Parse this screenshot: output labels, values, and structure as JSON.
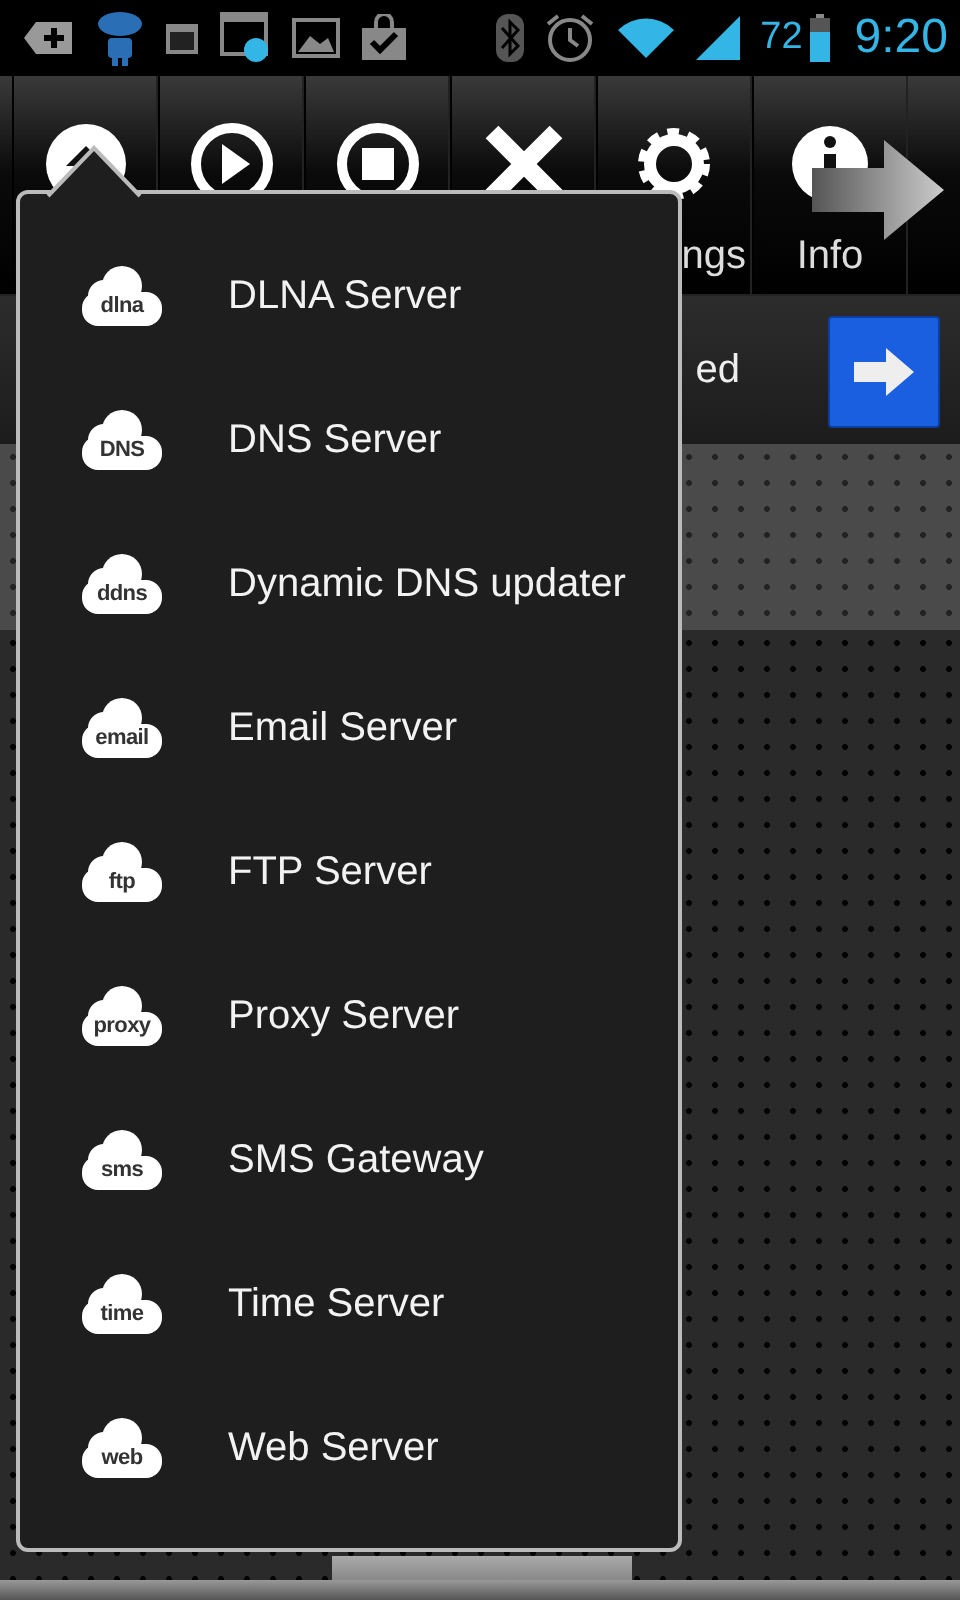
{
  "status_bar": {
    "battery_percent": "72",
    "time": "9:20"
  },
  "toolbar": {
    "buttons": [
      {
        "kind": "home"
      },
      {
        "kind": "play"
      },
      {
        "kind": "stop"
      },
      {
        "kind": "close"
      },
      {
        "kind": "settings",
        "label": "ngs"
      },
      {
        "kind": "info",
        "label": "Info"
      }
    ]
  },
  "status_row": {
    "text": "ed"
  },
  "menu": {
    "items": [
      {
        "icon_text": "dlna",
        "label": "DLNA Server"
      },
      {
        "icon_text": "DNS",
        "label": "DNS Server"
      },
      {
        "icon_text": "ddns",
        "label": "Dynamic DNS updater"
      },
      {
        "icon_text": "email",
        "label": "Email Server"
      },
      {
        "icon_text": "ftp",
        "label": "FTP Server"
      },
      {
        "icon_text": "proxy",
        "label": "Proxy Server"
      },
      {
        "icon_text": "sms",
        "label": "SMS Gateway"
      },
      {
        "icon_text": "time",
        "label": "Time Server"
      },
      {
        "icon_text": "web",
        "label": "Web Server"
      }
    ]
  }
}
